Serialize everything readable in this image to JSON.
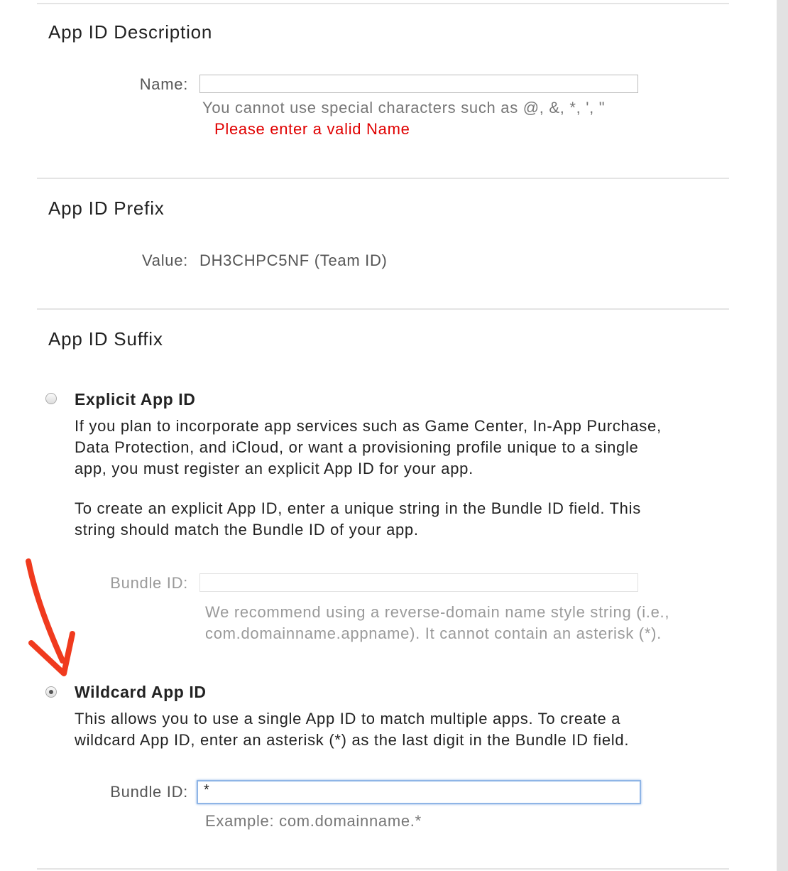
{
  "description": {
    "heading": "App ID Description",
    "name_label": "Name:",
    "name_value": "",
    "hint": "You cannot use special characters such as @, &, *, ', \"",
    "error": "Please enter a valid Name",
    "error_color": "#e00000"
  },
  "prefix": {
    "heading": "App ID Prefix",
    "value_label": "Value:",
    "value": "DH3CHPC5NF (Team ID)"
  },
  "suffix": {
    "heading": "App ID Suffix",
    "explicit": {
      "title": "Explicit App ID",
      "selected": false,
      "para1": [
        "If you plan to incorporate app services such as Game Center, In-App Purchase,",
        "Data Protection, and iCloud, or want a provisioning profile unique to a single",
        "app, you must register an explicit App ID for your app."
      ],
      "para2": [
        "To create an explicit App ID, enter a unique string in the Bundle ID field. This",
        "string should match the Bundle ID of your app."
      ],
      "bundle_label": "Bundle ID:",
      "bundle_value": "",
      "hint": [
        "We recommend using a reverse-domain name style string (i.e.,",
        "com.domainname.appname). It cannot contain an asterisk (*)."
      ]
    },
    "wildcard": {
      "title": "Wildcard App ID",
      "selected": true,
      "para": [
        "This allows you to use a single App ID to match multiple apps. To create a",
        "wildcard App ID, enter an asterisk (*) as the last digit in the Bundle ID field."
      ],
      "bundle_label": "Bundle ID:",
      "bundle_value": "*",
      "example": "Example: com.domainname.*"
    }
  },
  "annotation": {
    "icon": "red-arrow-icon",
    "color": "#f03a1e"
  }
}
